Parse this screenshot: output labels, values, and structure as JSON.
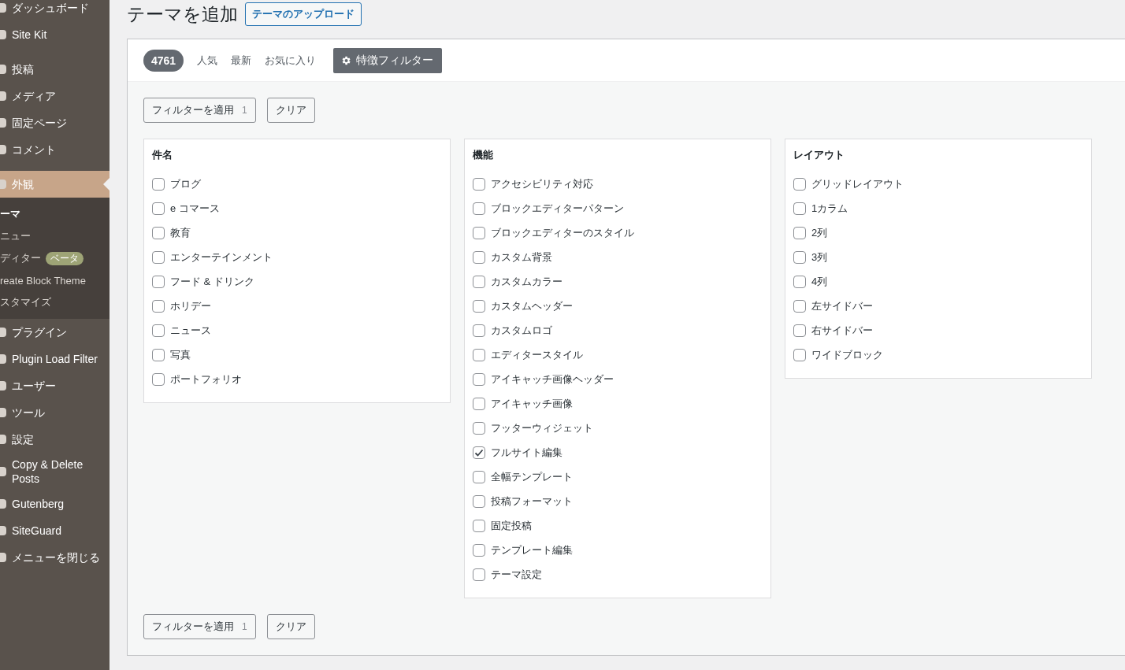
{
  "sidebar": {
    "groups": [
      [
        {
          "label": "ダッシュボード",
          "selected": false
        },
        {
          "label": "Site Kit",
          "selected": false
        }
      ],
      [
        {
          "label": "投稿",
          "selected": false
        },
        {
          "label": "メディア",
          "selected": false
        },
        {
          "label": "固定ページ",
          "selected": false
        },
        {
          "label": "コメント",
          "selected": false
        }
      ],
      [
        {
          "label": "外観",
          "selected": true,
          "children": [
            {
              "label": "ーマ",
              "selected": true
            },
            {
              "label": "ニュー",
              "selected": false
            },
            {
              "label": "ディター",
              "badge": "ベータ",
              "selected": false
            },
            {
              "label": "reate Block Theme",
              "selected": false
            },
            {
              "label": "スタマイズ",
              "selected": false
            }
          ]
        },
        {
          "label": "プラグイン",
          "selected": false
        },
        {
          "label": "Plugin Load Filter",
          "selected": false
        },
        {
          "label": "ユーザー",
          "selected": false
        },
        {
          "label": "ツール",
          "selected": false
        },
        {
          "label": "設定",
          "selected": false
        },
        {
          "label": "Copy & Delete Posts",
          "selected": false
        },
        {
          "label": "Gutenberg",
          "selected": false
        },
        {
          "label": "SiteGuard",
          "selected": false
        },
        {
          "label": "メニューを閉じる",
          "selected": false
        }
      ]
    ]
  },
  "page": {
    "title": "テーマを追加",
    "upload_button": "テーマのアップロード"
  },
  "filter_bar": {
    "count": "4761",
    "tabs": [
      {
        "label": "人気",
        "selected": false
      },
      {
        "label": "最新",
        "selected": false
      },
      {
        "label": "お気に入り",
        "selected": false
      }
    ],
    "feature_filter": {
      "label": "特徴フィルター",
      "selected": true
    }
  },
  "actions_top": {
    "apply": "フィルターを適用",
    "apply_count": "1",
    "clear": "クリア"
  },
  "groups": [
    {
      "title": "件名",
      "options": [
        {
          "label": "ブログ",
          "checked": false
        },
        {
          "label": "e コマース",
          "checked": false
        },
        {
          "label": "教育",
          "checked": false
        },
        {
          "label": "エンターテインメント",
          "checked": false
        },
        {
          "label": "フード & ドリンク",
          "checked": false
        },
        {
          "label": "ホリデー",
          "checked": false
        },
        {
          "label": "ニュース",
          "checked": false
        },
        {
          "label": "写真",
          "checked": false
        },
        {
          "label": "ポートフォリオ",
          "checked": false
        }
      ]
    },
    {
      "title": "機能",
      "options": [
        {
          "label": "アクセシビリティ対応",
          "checked": false
        },
        {
          "label": "ブロックエディターパターン",
          "checked": false
        },
        {
          "label": "ブロックエディターのスタイル",
          "checked": false
        },
        {
          "label": "カスタム背景",
          "checked": false
        },
        {
          "label": "カスタムカラー",
          "checked": false
        },
        {
          "label": "カスタムヘッダー",
          "checked": false
        },
        {
          "label": "カスタムロゴ",
          "checked": false
        },
        {
          "label": "エディタースタイル",
          "checked": false
        },
        {
          "label": "アイキャッチ画像ヘッダー",
          "checked": false
        },
        {
          "label": "アイキャッチ画像",
          "checked": false
        },
        {
          "label": "フッターウィジェット",
          "checked": false
        },
        {
          "label": "フルサイト編集",
          "checked": true
        },
        {
          "label": "全幅テンプレート",
          "checked": false
        },
        {
          "label": "投稿フォーマット",
          "checked": false
        },
        {
          "label": "固定投稿",
          "checked": false
        },
        {
          "label": "テンプレート編集",
          "checked": false
        },
        {
          "label": "テーマ設定",
          "checked": false
        }
      ]
    },
    {
      "title": "レイアウト",
      "options": [
        {
          "label": "グリッドレイアウト",
          "checked": false
        },
        {
          "label": "1カラム",
          "checked": false
        },
        {
          "label": "2列",
          "checked": false
        },
        {
          "label": "3列",
          "checked": false
        },
        {
          "label": "4列",
          "checked": false
        },
        {
          "label": "左サイドバー",
          "checked": false
        },
        {
          "label": "右サイドバー",
          "checked": false
        },
        {
          "label": "ワイドブロック",
          "checked": false
        }
      ]
    }
  ],
  "actions_bottom": {
    "apply": "フィルターを適用",
    "apply_count": "1",
    "clear": "クリア"
  }
}
